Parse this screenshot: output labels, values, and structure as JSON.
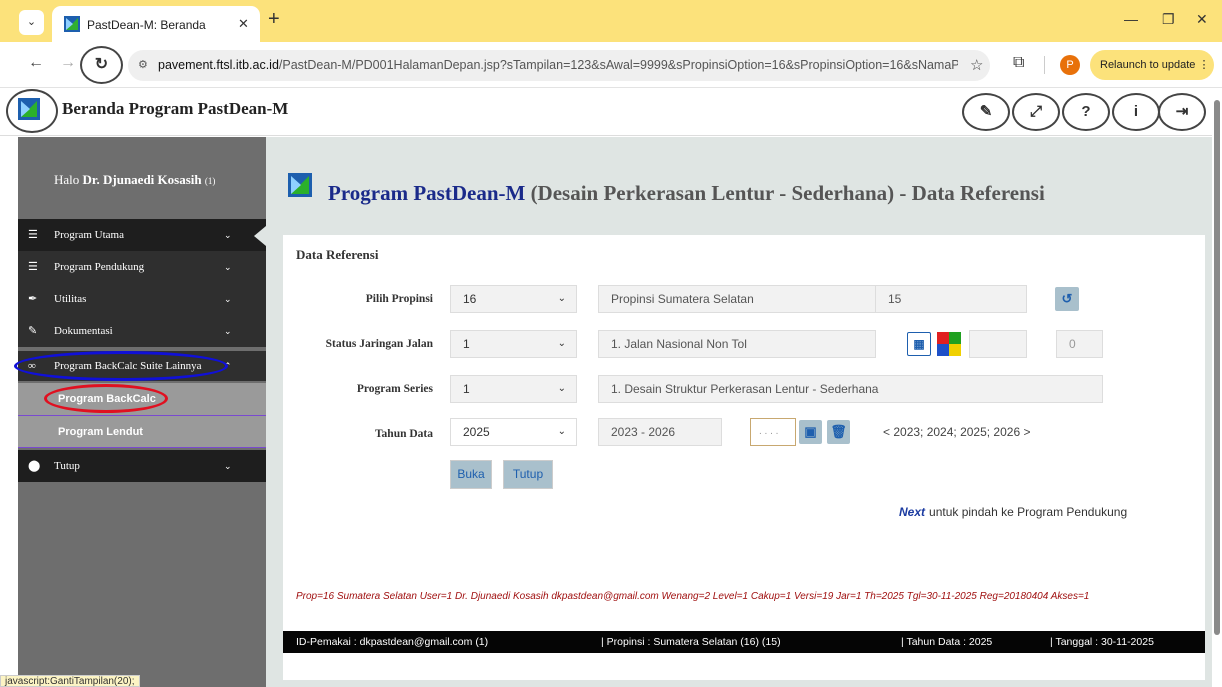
{
  "browser": {
    "tab_title": "PastDean-M: Beranda",
    "url_domain": "pavement.ftsl.itb.ac.id",
    "url_path": "/PastDean-M/PD001HalamanDepan.jsp?sTampilan=123&sAwal=9999&sPropinsiOption=16&sPropinsiOption=16&sNamaP...",
    "profile_initial": "P",
    "relaunch_label": "Relaunch to update"
  },
  "header": {
    "title": "Beranda Program PastDean-M",
    "icons": [
      "pencil-icon",
      "expand-icon",
      "question-icon",
      "info-icon",
      "logout-icon"
    ]
  },
  "sidebar": {
    "greeting": "Halo ",
    "user_name": "Dr. Djunaedi Kosasih",
    "user_level": "(1)",
    "menu": [
      {
        "label": "Program Utama",
        "icon": "list-icon"
      },
      {
        "label": "Program Pendukung",
        "icon": "list-icon"
      },
      {
        "label": "Utilitas",
        "icon": "feather-icon"
      },
      {
        "label": "Dokumentasi",
        "icon": "pencil-icon"
      },
      {
        "label": "Program BackCalc Suite Lainnya",
        "icon": "link-icon"
      }
    ],
    "submenu": [
      {
        "label": "Program BackCalc"
      },
      {
        "label": "Program Lendut"
      }
    ],
    "close_label": "Tutup",
    "status_tip": "javascript:GantiTampilan(20);"
  },
  "main": {
    "title_bold": "Program PastDean-M",
    "title_rest": " (Desain Perkerasan Lentur - Sederhana) - Data Referensi",
    "card_title": "Data Referensi",
    "form": {
      "propinsi_label": "Pilih Propinsi",
      "propinsi_value": "16",
      "propinsi_name": "Propinsi Sumatera Selatan",
      "propinsi_code": "15",
      "status_label": "Status Jaringan Jalan",
      "status_value": "1",
      "status_name": "1. Jalan Nasional Non Tol",
      "status_count": "0",
      "series_label": "Program Series",
      "series_value": "1",
      "series_name": "1. Desain Struktur Perkerasan Lentur - Sederhana",
      "tahun_label": "Tahun Data",
      "tahun_value": "2025",
      "tahun_range": "2023 - 2026",
      "tahun_input": ". . . .",
      "tahun_list": "< 2023; 2024; 2025; 2026 >"
    },
    "buttons": {
      "open": "Buka",
      "close": "Tutup"
    },
    "next_link": "Next",
    "next_text": "untuk pindah ke Program Pendukung",
    "status_line": "Prop=16 Sumatera Selatan  User=1 Dr. Djunaedi Kosasih dkpastdean@gmail.com  Wenang=2  Level=1  Cakup=1  Versi=19  Jar=1  Th=2025  Tgl=30-11-2025  Reg=20180404  Akses=1",
    "footer": {
      "user": "ID-Pemakai : dkpastdean@gmail.com (1)",
      "province": "| Propinsi : Sumatera Selatan (16) (15)",
      "year": "| Tahun Data : 2025",
      "date": "| Tanggal : 30-11-2025"
    }
  },
  "colors": {
    "accent": "#1a2a8a",
    "button_bg": "#a9c0cc",
    "sidebar_bg": "#6e6e6e",
    "tab_bar": "#fce27b"
  }
}
